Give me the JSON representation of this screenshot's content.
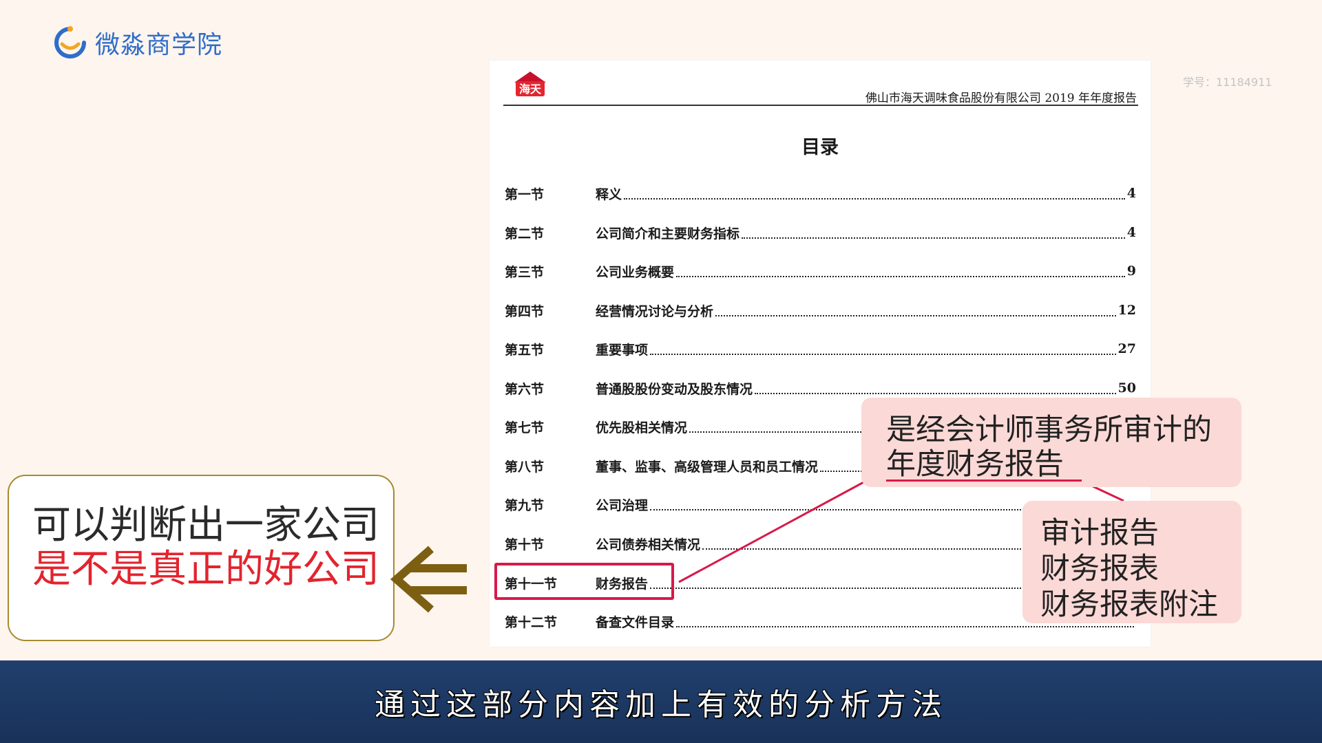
{
  "brand": {
    "name": "微淼商学院",
    "icon": "brand-logo-icon"
  },
  "student_id": "学号：11184911",
  "document": {
    "logo_text": "海天",
    "header": "佛山市海天调味食品股份有限公司 2019 年年度报告",
    "title": "目录",
    "toc": [
      {
        "section": "第一节",
        "title": "释义",
        "page": "4"
      },
      {
        "section": "第二节",
        "title": "公司简介和主要财务指标",
        "page": "4"
      },
      {
        "section": "第三节",
        "title": "公司业务概要",
        "page": "9"
      },
      {
        "section": "第四节",
        "title": "经营情况讨论与分析",
        "page": "12"
      },
      {
        "section": "第五节",
        "title": "重要事项",
        "page": "27"
      },
      {
        "section": "第六节",
        "title": "普通股股份变动及股东情况",
        "page": "50"
      },
      {
        "section": "第七节",
        "title": "优先股相关情况",
        "page": ""
      },
      {
        "section": "第八节",
        "title": "董事、监事、高级管理人员和员工情况",
        "page": ""
      },
      {
        "section": "第九节",
        "title": "公司治理",
        "page": ""
      },
      {
        "section": "第十节",
        "title": "公司债券相关情况",
        "page": ""
      },
      {
        "section": "第十一节",
        "title": "财务报告",
        "page": ""
      },
      {
        "section": "第十二节",
        "title": "备查文件目录",
        "page": ""
      }
    ],
    "highlighted_index": 10
  },
  "left_callout": {
    "line1": "可以判断出一家公司",
    "line2": "是不是真正的好公司"
  },
  "audit_callout": {
    "line1": "是经会计师事务所审计的",
    "line2": "年度财务报告"
  },
  "parts_callout": {
    "items": [
      "审计报告",
      "财务报表",
      "财务报表附注"
    ]
  },
  "subtitle": "通过这部分内容加上有效的分析方法",
  "colors": {
    "background": "#fdf5ee",
    "brand_blue": "#2f6dc9",
    "highlight_red": "#d8194a",
    "callout_pink": "#fbd9d6",
    "text_red": "#e2242e",
    "arrow_gold": "#7d5f12",
    "subtitle_bar": "#1e3a66"
  }
}
